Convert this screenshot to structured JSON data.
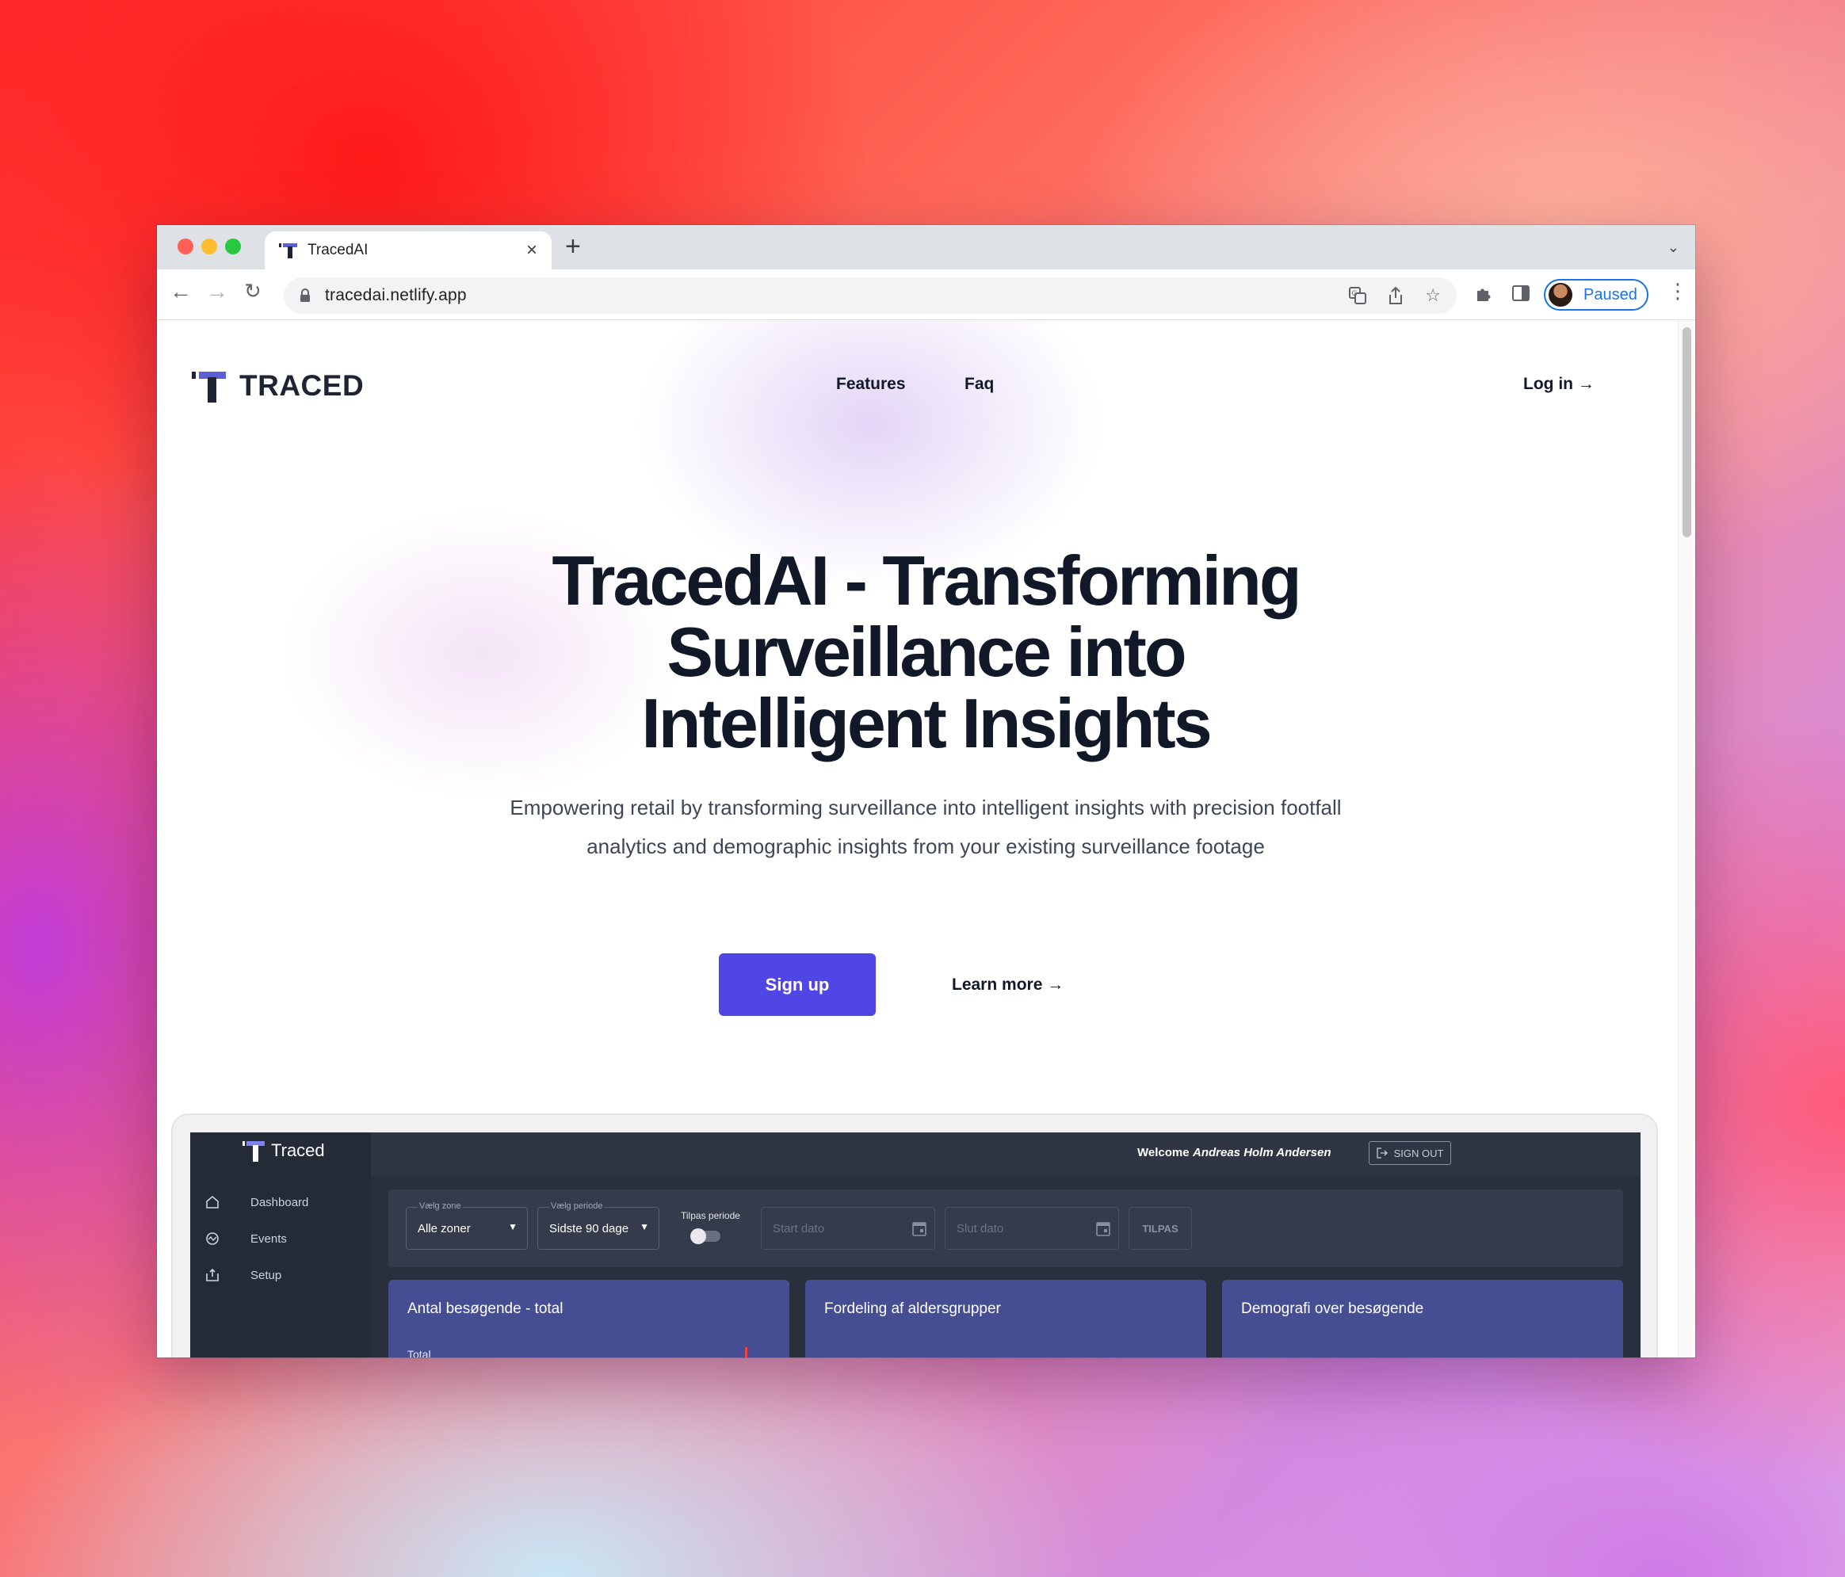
{
  "browser": {
    "tab_title": "TracedAI",
    "url": "tracedai.netlify.app",
    "profile_label": "Paused",
    "accent": "#1a73e8"
  },
  "site": {
    "logo_text": "TRACED",
    "nav": [
      "Features",
      "Faq"
    ],
    "login": "Log in →",
    "hero_title_lines": [
      "TracedAI - Transforming",
      "Surveillance into",
      "Intelligent Insights"
    ],
    "hero_subtitle": "Empowering retail by transforming surveillance into intelligent insights with precision footfall analytics and demographic insights from your existing surveillance footage",
    "primary_cta": "Sign up",
    "secondary_cta": "Learn more →",
    "brand_color": "#4f46e5"
  },
  "dashboard": {
    "logo_text": "Traced",
    "sidebar": [
      {
        "label": "Dashboard",
        "icon": "home-icon"
      },
      {
        "label": "Events",
        "icon": "events-icon"
      },
      {
        "label": "Setup",
        "icon": "setup-icon"
      }
    ],
    "welcome_label": "Welcome",
    "user_name": "Andreas Holm Andersen",
    "signout_label": "SIGN OUT",
    "filters": {
      "zone_label": "Vælg zone",
      "zone_value": "Alle zoner",
      "period_label": "Vælg periode",
      "period_value": "Sidste 90 dage",
      "custom_period_label": "Tilpas periode",
      "custom_period_on": false,
      "start_placeholder": "Start dato",
      "end_placeholder": "Slut dato",
      "apply_label": "TILPAS"
    },
    "cards": [
      {
        "title": "Antal besøgende - total",
        "sub": "Total"
      },
      {
        "title": "Fordeling af aldersgrupper"
      },
      {
        "title": "Demografi over besøgende"
      }
    ],
    "card_color": "#454e93"
  }
}
